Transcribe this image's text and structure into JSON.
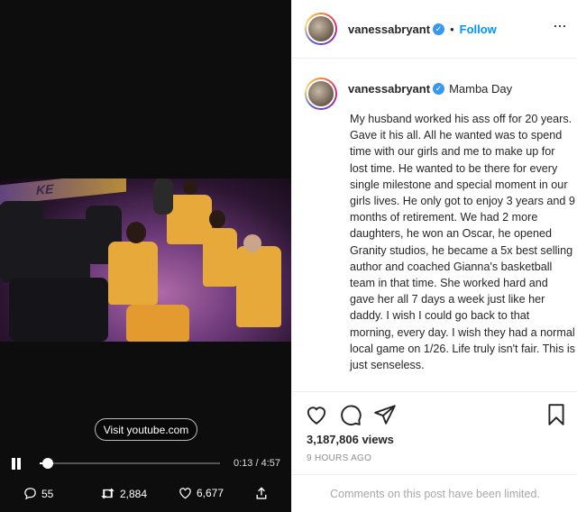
{
  "video": {
    "court_text": "KE",
    "visit_button": "Visit youtube.com",
    "time": "0:13 / 4:57",
    "progress": 0.045,
    "replies": "55",
    "retweets": "2,884",
    "likes": "6,677"
  },
  "header": {
    "username": "vanessabryant",
    "follow_label": "Follow"
  },
  "caption": {
    "username": "vanessabryant",
    "title": "Mamba Day",
    "body": "My husband worked his ass off for 20 years. Gave it his all. All he wanted was to spend time with our girls and me to make up for lost time. He wanted to be there for every single milestone and special moment in our girls lives. He only got to enjoy 3 years and 9 months of retirement. We had 2 more daughters, he won an Oscar, he opened Granity studios, he became a 5x best selling author and coached Gianna's basketball team in that time. She worked hard and gave her all 7 days a week just like her daddy. I wish I could go back to that morning, every day. I wish they had a normal local game on 1/26. Life truly isn't fair. This is just senseless."
  },
  "stats": {
    "views": "3,187,806 views",
    "posted": "9 HOURS AGO"
  },
  "footer": {
    "comments_limited": "Comments on this post have been limited."
  },
  "colors": {
    "link_blue": "#0095f6",
    "verified_blue": "#3897f0",
    "muted_gray": "#8e8e8e"
  }
}
